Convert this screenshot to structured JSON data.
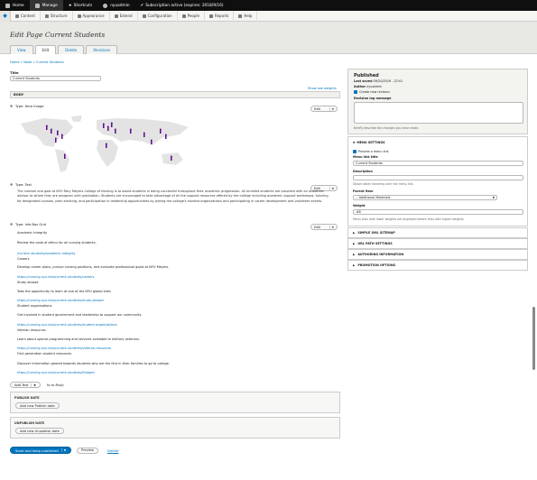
{
  "toolbar": {
    "home": "Home",
    "manage": "Manage",
    "shortcuts": "Shortcuts",
    "user": "nyuadmin",
    "subscription": "Subscription active (expires: 2018/9/16)"
  },
  "menu": {
    "items": [
      "Content",
      "Structure",
      "Appearance",
      "Extend",
      "Configuration",
      "People",
      "Reports",
      "Help"
    ]
  },
  "page": {
    "title": "Edit Page Current Students",
    "tabs": [
      "View",
      "Edit",
      "Delete",
      "Revisions"
    ],
    "breadcrumb": "Home » Node » Current Students"
  },
  "form": {
    "title_label": "Title",
    "title_value": "Current Students",
    "show_weights": "Show row weights",
    "body_label": "BODY",
    "edit_label": "Edit",
    "p1_type": "Type: Hero Image",
    "p2_type": "Type: Text",
    "p2_text": "The number one goal at NYU Rory Meyers College of Nursing is to assist students in being successful throughout their academic progression. All enrolled students are provided with an academic advisor to whom they are assigned until graduation. Students are encouraged to take advantage of all the support resources offered by the college including academic support workshops, tutoring for designated courses, peer advising, and participation in leadership opportunities by joining the college's student organizations and participating in career development and volunteer events.",
    "p3_type": "Type: Info Box Grid",
    "grid": [
      "Academic Integrity",
      "Review the code of ethics for all nursing students.",
      "/current-students/academic-integrity",
      "Careers",
      "Develop career plans, pursue nursing positions, and evaluate professional goals at NYU Meyers.",
      "https://nursing.nyu.edu/current-students/careers",
      "Study abroad",
      "Take the opportunity to learn at one of the NYU global sites",
      "https://nursing.nyu.edu/current-students/study-abroad",
      "Student organizations",
      "Get involved in student government and leadership to support our community.",
      "https://nursing.nyu.edu/current-students/student-organizations",
      "Veteran resources",
      "Learn about special programming and services available to military veterans.",
      "https://nursing.nyu.edu/current-students/veteran-resources",
      "First generation student resources",
      "Discover information geared towards students who are the first in their families to go to college.",
      "https://nursing.nyu.edu/current-students/firstgen"
    ],
    "add_text": "Add Text",
    "to_body": "to Body",
    "publish_date_label": "PUBLISH DATE",
    "add_publish": "Add new Publish date",
    "unpublish_date_label": "UNPUBLISH DATE",
    "add_unpublish": "Add new Unpublish date",
    "save": "Save and keep published",
    "preview": "Preview",
    "delete": "Delete"
  },
  "sidebar": {
    "published": "Published",
    "last_saved_label": "Last saved",
    "last_saved_value": "09/20/2016 - 22:01",
    "author_label": "Author",
    "author_value": "nyuadmin",
    "create_revision": "Create new revision",
    "revision_log_label": "Revision log message",
    "revision_desc": "Briefly describe the changes you have made.",
    "menu_settings": "MENU SETTINGS",
    "provide_menu": "Provide a menu link",
    "menu_title_label": "Menu link title",
    "menu_title_value": "Current Students",
    "description_label": "Description",
    "description_hint": "Shown when hovering over the menu link.",
    "parent_label": "Parent item",
    "parent_value": "-- Additional Materials",
    "weight_label": "Weight",
    "weight_value": "-86",
    "weight_hint": "Menu links with lower weights are displayed before links with higher weights.",
    "sections": [
      "SIMPLE XML SITEMAP",
      "URL PATH SETTINGS",
      "AUTHORING INFORMATION",
      "PROMOTION OPTIONS"
    ]
  }
}
